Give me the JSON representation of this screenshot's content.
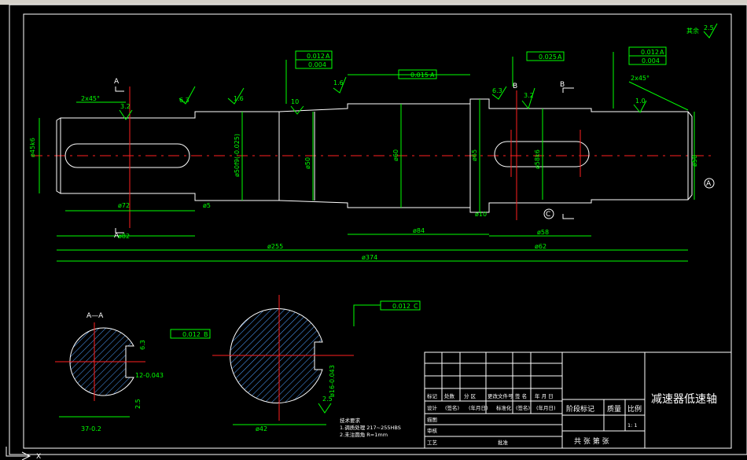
{
  "drawing": {
    "title": "减速器低速轴",
    "dimensions": {
      "d_left_end": "ø45k6",
      "d_key1_len": "ø72",
      "d_5": "ø5",
      "d_82": "ø82",
      "d_255": "ø255",
      "d_374": "ø374",
      "d_84": "ø84",
      "d_58": "ø58",
      "d_62": "ø62",
      "d_10": "ø10",
      "d_50f9": "ø50f9(-0.025)",
      "d_50": "ø50",
      "d_60": "ø60",
      "d_65": "ø65",
      "d_58k6": "ø58k6",
      "d_50r": "ø50",
      "chamfer_left": "2x45°",
      "chamfer_right": "2x45°",
      "sec_a_width": "12-0.043",
      "sec_a_depth": "37-0.2",
      "sec_b_dia": "ø42",
      "sec_b_key": "ø16-0.043",
      "sec_a_25": "2.5",
      "sec_a_63": "6.3"
    },
    "tolerances": {
      "t1": "0.012",
      "t1_ref": "A",
      "t2": "0.004",
      "t3": "0.015",
      "t3_ref": "A",
      "t4": "0.025",
      "t4_ref": "A",
      "t5": "0.012",
      "t5_ref": "A",
      "t6": "0.004",
      "t7": "0.012",
      "t7_ref": "B",
      "t8": "0.012",
      "t8_ref": "C"
    },
    "roughness": {
      "r32a": "3.2",
      "r63": "6.3",
      "r16": "1.6",
      "r10a": "10",
      "r16b": "1.6",
      "r32b": "3.2",
      "r10b": "1.0",
      "r25": "2.5",
      "r63b": "6.3",
      "r25b": "2.5",
      "rest": "其余"
    },
    "section_labels": {
      "a": "A",
      "b": "B",
      "c": "C",
      "aa": "A—A",
      "datum_a": "A",
      "datum_b": "B",
      "datum_c": "C"
    },
    "tech_req": {
      "heading": "技术要求",
      "line1": "1.调质处理 217~255HBS",
      "line2": "2.未注圆角 R=1mm"
    },
    "title_block": {
      "mark": "标记",
      "count": "处数",
      "zone": "分 区",
      "docno": "更改文件号",
      "sign": "签 名",
      "date": "年 月 日",
      "design": "设计",
      "sig1": "(签名)",
      "ymd1": "(年月日)",
      "std": "标准化",
      "sig2": "(签名)",
      "ymd2": "(年月日)",
      "check": "描图",
      "review": "审核",
      "process": "工艺",
      "approve": "批准",
      "stage": "阶段标记",
      "mass": "质量",
      "scale": "比例",
      "scale_val": "1: 1",
      "sheets": "共  张  第  张"
    },
    "ucs": {
      "x": "X"
    }
  }
}
